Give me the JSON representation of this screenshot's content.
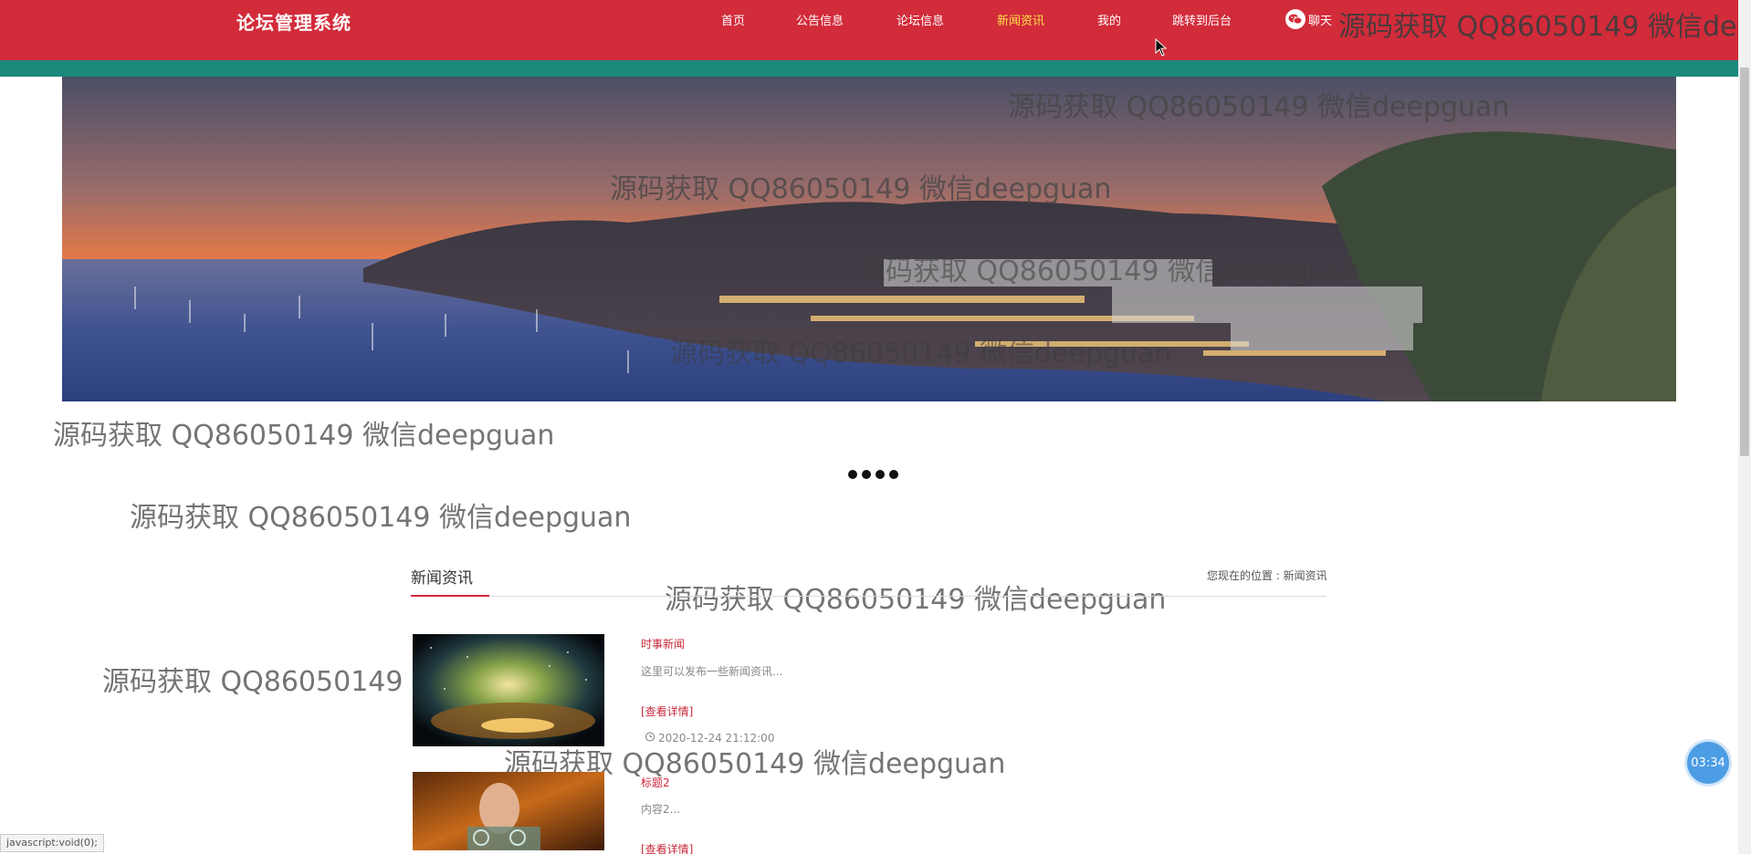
{
  "header": {
    "site_title": "论坛管理系统",
    "nav": [
      "首页",
      "公告信息",
      "论坛信息",
      "新闻资讯",
      "我的",
      "跳转到后台"
    ],
    "active_nav": "新闻资讯",
    "chat_label": "聊天"
  },
  "colors": {
    "header_bg": "#d22b3a",
    "accent_bar": "#1b8a7c",
    "active_nav": "#ffe14a",
    "link_red": "#c8283a"
  },
  "carousel": {
    "slide_count": 4
  },
  "section": {
    "title": "新闻资讯",
    "breadcrumb": "您现在的位置 : 新闻资讯"
  },
  "news": [
    {
      "category": "时事新闻",
      "desc": "这里可以发布一些新闻资讯...",
      "more": "[查看详情]",
      "date": "2020-12-24 21:12:00"
    },
    {
      "category": "标题2",
      "desc": "内容2...",
      "more": "[查看详情]",
      "date": ""
    }
  ],
  "watermark": "源码获取 QQ86050149 微信deepguan",
  "watermark_top": "源码获取 QQ86050149 微信deep",
  "timer": "03:34",
  "status_bar": "javascript:void(0);"
}
